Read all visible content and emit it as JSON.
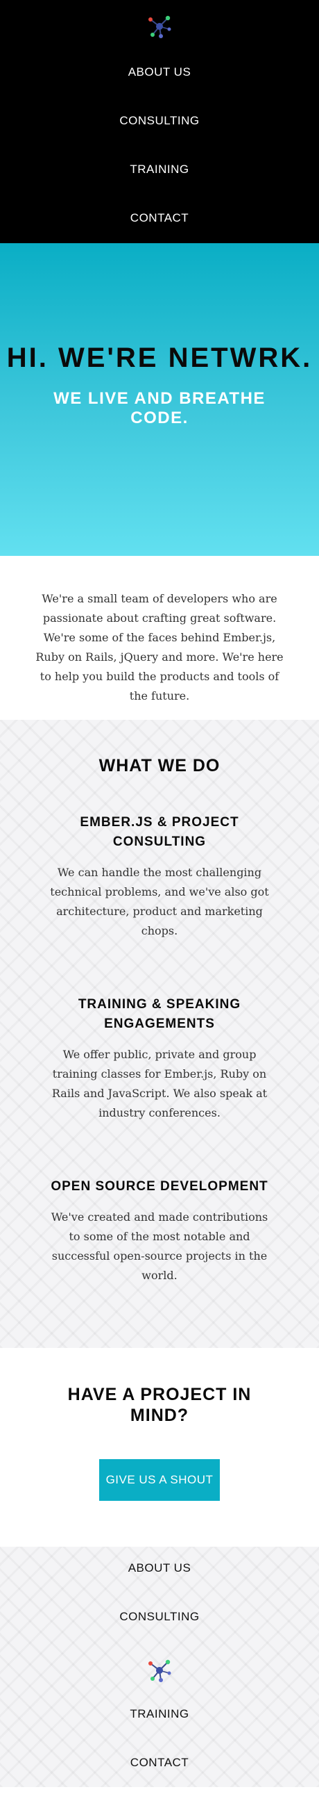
{
  "header": {
    "logo_icon": "network-node-icon",
    "nav": [
      {
        "label": "ABOUT US"
      },
      {
        "label": "CONSULTING"
      },
      {
        "label": "TRAINING"
      },
      {
        "label": "CONTACT"
      }
    ]
  },
  "hero": {
    "title": "HI. WE'RE NETWRK.",
    "subtitle": "WE LIVE AND BREATHE CODE."
  },
  "intro": {
    "text": "We're a small team of developers who are passionate about crafting great software. We're some of the faces behind Ember.js, Ruby on Rails, jQuery and more. We're here to help you build the products and tools of the future."
  },
  "what_we_do": {
    "heading": "WHAT WE DO",
    "services": [
      {
        "title": "EMBER.JS & PROJECT CONSULTING",
        "body": "We can handle the most challenging technical problems, and we've also got architecture, product and marketing chops."
      },
      {
        "title": "TRAINING & SPEAKING ENGAGEMENTS",
        "body": "We offer public, private and group training classes for Ember.js, Ruby on Rails and JavaScript. We also speak at industry conferences."
      },
      {
        "title": "OPEN SOURCE DEVELOPMENT",
        "body": "We've created and made contributions to some of the most notable and successful open-source projects in the world."
      }
    ]
  },
  "cta": {
    "heading": "HAVE A PROJECT IN MIND?",
    "button_label": "GIVE US A SHOUT"
  },
  "footer": {
    "nav_top": [
      {
        "label": "ABOUT US"
      },
      {
        "label": "CONSULTING"
      }
    ],
    "logo_icon": "network-node-icon",
    "nav_bottom": [
      {
        "label": "TRAINING"
      },
      {
        "label": "CONTACT"
      }
    ]
  },
  "colors": {
    "accent": "#0aaec5",
    "hero_gradient_top": "#0aaec5",
    "hero_gradient_bottom": "#62e0f0",
    "nav_bg": "#000000",
    "pattern_bg": "#f4f4f6"
  }
}
